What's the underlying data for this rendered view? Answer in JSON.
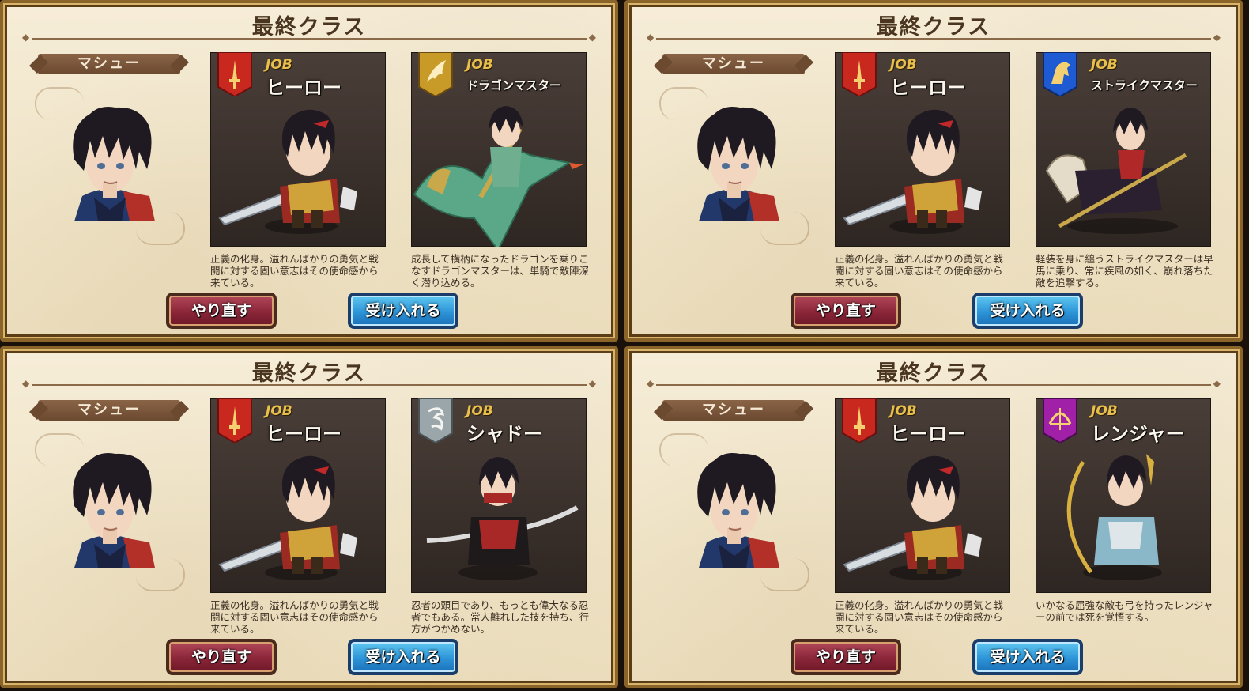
{
  "panels": [
    {
      "title": "最終クラス",
      "character_name": "マシュー",
      "current_job": {
        "job_label": "JOB",
        "name": "ヒーロー",
        "badge_color": "#c8281e",
        "icon": "sword-icon",
        "description": "正義の化身。溢れんばかりの勇気と戦闘に対する固い意志はその使命感から来ている。"
      },
      "next_job": {
        "job_label": "JOB",
        "name": "ドラゴンマスター",
        "badge_color": "#c89b28",
        "icon": "wing-icon",
        "description": "成長して横柄になったドラゴンを乗りこなすドラゴンマスターは、単騎で敵陣深く潜り込める。"
      },
      "redo_label": "やり直す",
      "accept_label": "受け入れる"
    },
    {
      "title": "最終クラス",
      "character_name": "マシュー",
      "current_job": {
        "job_label": "JOB",
        "name": "ヒーロー",
        "badge_color": "#c8281e",
        "icon": "sword-icon",
        "description": "正義の化身。溢れんばかりの勇気と戦闘に対する固い意志はその使命感から来ている。"
      },
      "next_job": {
        "job_label": "JOB",
        "name": "ストライクマスター",
        "badge_color": "#1e5ad2",
        "icon": "horse-icon",
        "description": "軽装を身に纏うストライクマスターは早馬に乗り、常に疾風の如く、崩れ落ちた敵を追撃する。"
      },
      "redo_label": "やり直す",
      "accept_label": "受け入れる"
    },
    {
      "title": "最終クラス",
      "character_name": "マシュー",
      "current_job": {
        "job_label": "JOB",
        "name": "ヒーロー",
        "badge_color": "#c8281e",
        "icon": "sword-icon",
        "description": "正義の化身。溢れんばかりの勇気と戦闘に対する固い意志はその使命感から来ている。"
      },
      "next_job": {
        "job_label": "JOB",
        "name": "シャドー",
        "badge_color": "#9aa6aa",
        "icon": "shadow-icon",
        "description": "忍者の頭目であり、もっとも偉大なる忍者でもある。常人離れした技を持ち、行方がつかめない。"
      },
      "redo_label": "やり直す",
      "accept_label": "受け入れる"
    },
    {
      "title": "最終クラス",
      "character_name": "マシュー",
      "current_job": {
        "job_label": "JOB",
        "name": "ヒーロー",
        "badge_color": "#c8281e",
        "icon": "sword-icon",
        "description": "正義の化身。溢れんばかりの勇気と戦闘に対する固い意志はその使命感から来ている。"
      },
      "next_job": {
        "job_label": "JOB",
        "name": "レンジャー",
        "badge_color": "#a020a8",
        "icon": "bow-icon",
        "description": "いかなる屈強な敵も弓を持ったレンジャーの前では死を覚悟する。"
      },
      "redo_label": "やり直す",
      "accept_label": "受け入れる"
    }
  ]
}
